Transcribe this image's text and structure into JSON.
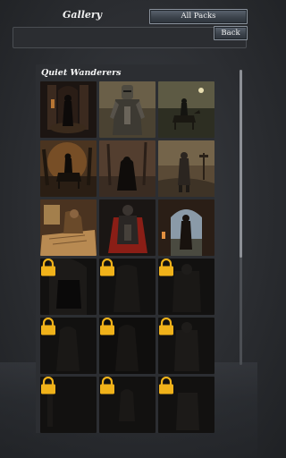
{
  "header": {
    "title": "Gallery",
    "all_packs_label": "All Packs",
    "back_label": "Back"
  },
  "section": {
    "title": "Quiet Wanderers"
  },
  "gallery": {
    "items": [
      {
        "name": "gothic-hall-knight",
        "state": "unlocked"
      },
      {
        "name": "armored-knight",
        "state": "unlocked"
      },
      {
        "name": "rider-at-dusk",
        "state": "unlocked"
      },
      {
        "name": "dark-rider-forest",
        "state": "unlocked"
      },
      {
        "name": "cloaked-figure-mist",
        "state": "unlocked"
      },
      {
        "name": "wanderer-signpost",
        "state": "unlocked"
      },
      {
        "name": "scholar-map-table",
        "state": "unlocked"
      },
      {
        "name": "red-cloak-warrior",
        "state": "unlocked"
      },
      {
        "name": "figure-in-archway",
        "state": "unlocked"
      },
      {
        "name": "locked-1",
        "state": "locked"
      },
      {
        "name": "locked-2",
        "state": "locked"
      },
      {
        "name": "locked-3",
        "state": "locked"
      },
      {
        "name": "locked-4",
        "state": "locked"
      },
      {
        "name": "locked-5",
        "state": "locked"
      },
      {
        "name": "locked-6",
        "state": "locked"
      },
      {
        "name": "locked-7",
        "state": "locked"
      },
      {
        "name": "locked-8",
        "state": "locked"
      },
      {
        "name": "locked-9",
        "state": "locked"
      }
    ]
  },
  "colors": {
    "lock_gold": "#f0b21a",
    "button_border": "#8a929c"
  }
}
